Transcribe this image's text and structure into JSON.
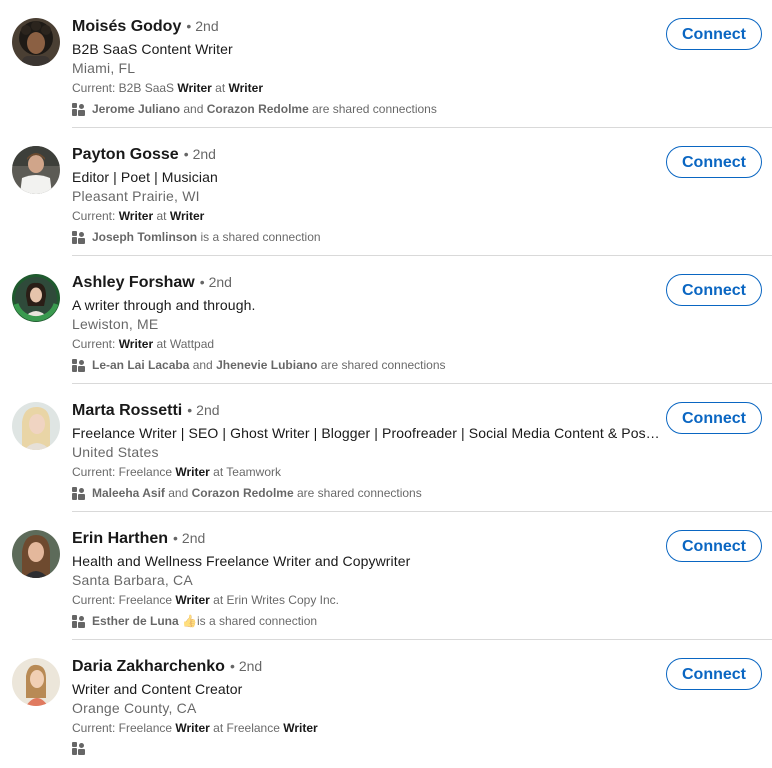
{
  "results": [
    {
      "name": "Moisés Godoy",
      "degree": "2nd",
      "headline": "B2B SaaS Content Writer",
      "location": "Miami, FL",
      "current": [
        {
          "text": "Current: B2B SaaS ",
          "bold": false
        },
        {
          "text": "Writer",
          "bold": true
        },
        {
          "text": " at ",
          "bold": false
        },
        {
          "text": "Writer",
          "bold": true
        }
      ],
      "shared": [
        {
          "text": "Jerome Juliano",
          "bold": true
        },
        {
          "text": " and ",
          "bold": false
        },
        {
          "text": "Corazon Redolme",
          "bold": true
        },
        {
          "text": " are shared connections",
          "bold": false
        }
      ],
      "connect_label": "Connect",
      "avatar_icon": "avatar-photo-dark-curly-hair"
    },
    {
      "name": "Payton Gosse",
      "degree": "2nd",
      "headline": "Editor | Poet | Musician",
      "location": "Pleasant Prairie, WI",
      "current": [
        {
          "text": "Current: ",
          "bold": false
        },
        {
          "text": "Writer",
          "bold": true
        },
        {
          "text": " at ",
          "bold": false
        },
        {
          "text": "Writer",
          "bold": true
        }
      ],
      "shared": [
        {
          "text": "Joseph Tomlinson",
          "bold": true
        },
        {
          "text": " is a shared connection",
          "bold": false
        }
      ],
      "connect_label": "Connect",
      "avatar_icon": "avatar-photo-white-shirt"
    },
    {
      "name": "Ashley Forshaw",
      "degree": "2nd",
      "headline": "A writer through and through.",
      "location": "Lewiston, ME",
      "current": [
        {
          "text": "Current: ",
          "bold": false
        },
        {
          "text": "Writer",
          "bold": true
        },
        {
          "text": " at Wattpad",
          "bold": false
        }
      ],
      "shared": [
        {
          "text": "Le-an Lai Lacaba",
          "bold": true
        },
        {
          "text": " and ",
          "bold": false
        },
        {
          "text": "Jhenevie Lubiano",
          "bold": true
        },
        {
          "text": " are shared connections",
          "bold": false
        }
      ],
      "connect_label": "Connect",
      "avatar_icon": "avatar-photo-open-to-work-frame"
    },
    {
      "name": "Marta Rossetti",
      "degree": "2nd",
      "headline": "Freelance Writer | SEO | Ghost Writer | Blogger | Proofreader | Social Media Content & Pos…",
      "location": "United States",
      "current": [
        {
          "text": "Current: Freelance ",
          "bold": false
        },
        {
          "text": "Writer",
          "bold": true
        },
        {
          "text": " at Teamwork",
          "bold": false
        }
      ],
      "shared": [
        {
          "text": "Maleeha Asif",
          "bold": true
        },
        {
          "text": " and ",
          "bold": false
        },
        {
          "text": "Corazon Redolme",
          "bold": true
        },
        {
          "text": " are shared connections",
          "bold": false
        }
      ],
      "connect_label": "Connect",
      "avatar_icon": "avatar-photo-blonde-hair"
    },
    {
      "name": "Erin Harthen",
      "degree": "2nd",
      "headline": "Health and Wellness Freelance Writer and Copywriter",
      "location": "Santa Barbara, CA",
      "current": [
        {
          "text": "Current: Freelance ",
          "bold": false
        },
        {
          "text": "Writer",
          "bold": true
        },
        {
          "text": " at Erin Writes Copy Inc.",
          "bold": false
        }
      ],
      "shared": [
        {
          "text": "Esther de Luna 👍",
          "bold": true
        },
        {
          "text": "is a shared connection",
          "bold": false
        }
      ],
      "connect_label": "Connect",
      "avatar_icon": "avatar-photo-brown-hair"
    },
    {
      "name": "Daria Zakharchenko",
      "degree": "2nd",
      "headline": "Writer and Content Creator",
      "location": "Orange County, CA",
      "current": [
        {
          "text": "Current: Freelance ",
          "bold": false
        },
        {
          "text": "Writer",
          "bold": true
        },
        {
          "text": " at Freelance ",
          "bold": false
        },
        {
          "text": "Writer",
          "bold": true
        }
      ],
      "shared": [],
      "connect_label": "Connect",
      "avatar_icon": "avatar-photo-light-background"
    }
  ],
  "colors": {
    "accent": "#0a66c2",
    "divider": "#d9d9d9",
    "text_primary": "rgba(0,0,0,0.9)",
    "text_secondary": "rgba(0,0,0,0.6)"
  }
}
